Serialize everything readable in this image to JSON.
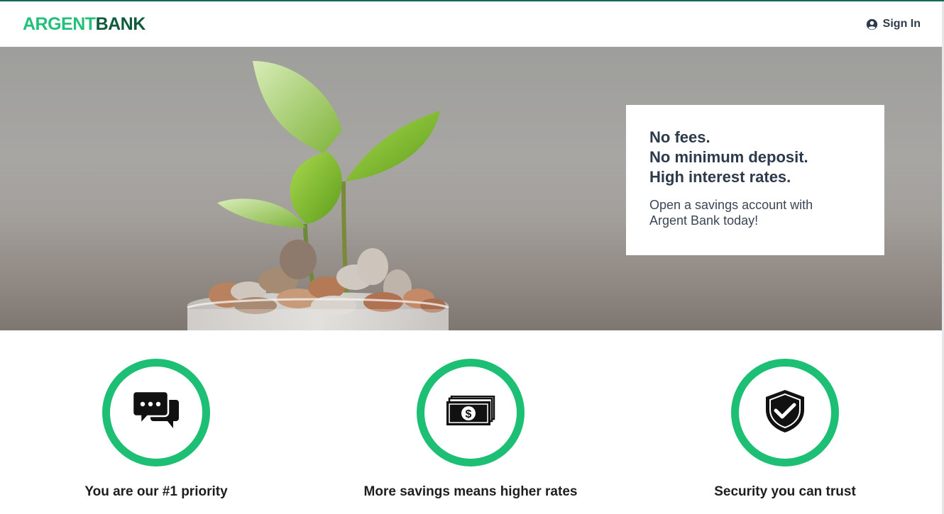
{
  "brand": {
    "part1": "ARGENT",
    "part2": "BANK"
  },
  "header": {
    "sign_in_label": "Sign In",
    "sign_in_icon": "user-circle-icon"
  },
  "hero": {
    "image_desc_icon": "plant-coins-image",
    "promo": {
      "line1": "No fees.",
      "line2": "No minimum deposit.",
      "line3": "High interest rates.",
      "body_line1": "Open a savings account with",
      "body_line2": "Argent Bank today!"
    }
  },
  "features": [
    {
      "icon": "chat-bubbles-icon",
      "title": "You are our #1 priority"
    },
    {
      "icon": "money-stack-icon",
      "title": "More savings means higher rates"
    },
    {
      "icon": "shield-check-icon",
      "title": "Security you can trust"
    }
  ],
  "colors": {
    "accent": "#1cbf74",
    "brand_light": "#22c07a",
    "brand_dark": "#0f5b3c",
    "text_dark": "#2c3a4b"
  }
}
